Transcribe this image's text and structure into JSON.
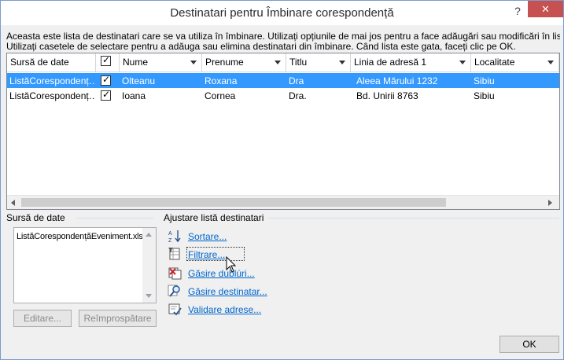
{
  "window": {
    "title": "Destinatari pentru Îmbinare corespondență",
    "help_label": "?",
    "close_label": "✕"
  },
  "instructions": {
    "line1": "Aceasta este lista de destinatari care se va utiliza în îmbinare. Utilizați opțiunile de mai jos pentru a face adăugări sau modificări în listă.",
    "line2": "Utilizați casetele de selectare pentru a adăuga sau elimina destinatari din îmbinare. Când lista este gata, faceți clic pe OK."
  },
  "grid": {
    "headers": [
      "Sursă de date",
      "",
      "Nume",
      "Prenume",
      "Titlu",
      "Linia de adresă 1",
      "Localitate"
    ],
    "rows": [
      {
        "source": "ListăCorespondenț…",
        "checked": true,
        "nume": "Olteanu",
        "prenume": "Roxana",
        "titlu": "Dra",
        "adresa": "Aleea Mărului 1232",
        "localitate": "Sibiu",
        "selected": true
      },
      {
        "source": "ListăCorespondenț…",
        "checked": true,
        "nume": "Ioana",
        "prenume": "Cornea",
        "titlu": "Dra.",
        "adresa": "Bd. Unirii 8763",
        "localitate": "Sibiu",
        "selected": false
      }
    ]
  },
  "data_source": {
    "label": "Sursă de date",
    "file": "ListăCorespondențăEveniment.xlsx",
    "edit_label": "Editare...",
    "refresh_label": "Reîmprospătare"
  },
  "adjust": {
    "label": "Ajustare listă destinatari",
    "sort": "Sortare...",
    "filter": "Filtrare...",
    "duplicates": "Găsire dublúri...",
    "find": "Găsire destinatar...",
    "validate": "Validare adrese..."
  },
  "ok_label": "OK",
  "colors": {
    "selection": "#3399ff",
    "link": "#0066cc",
    "close": "#c75050"
  }
}
